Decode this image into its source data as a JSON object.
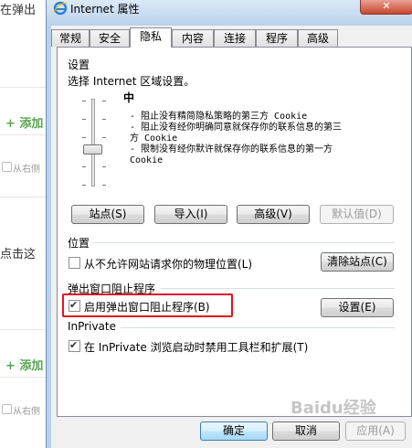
{
  "background": {
    "frag_title": "在弹出",
    "add_1": "+ 添加",
    "from_right_1": "从右侧",
    "frag_click": "点击这",
    "add_2": "+ 添加",
    "from_right_2": "从右侧"
  },
  "dialog": {
    "title": "Internet 属性",
    "close_symbol": "✕",
    "tabs": [
      "常规",
      "安全",
      "隐私",
      "内容",
      "连接",
      "程序",
      "高级"
    ],
    "active_tab": "隐私"
  },
  "settings": {
    "group_label": "设置",
    "select_label": "选择 Internet 区域设置。",
    "level": "中",
    "description": [
      "- 阻止没有精简隐私策略的第三方 Cookie",
      "- 阻止没有经你明确同意就保存你的联系信息的第三",
      "方 Cookie",
      "- 限制没有经你默许就保存你的联系信息的第一方",
      "Cookie"
    ],
    "buttons": {
      "sites": "站点(S)",
      "import": "导入(I)",
      "advanced": "高级(V)",
      "default": "默认值(D)"
    }
  },
  "location": {
    "group_label": "位置",
    "checkbox_label": "从不允许网站请求你的物理位置(L)",
    "checked": false,
    "clear_button": "清除站点(C)"
  },
  "popup": {
    "group_label": "弹出窗口阻止程序",
    "checkbox_label": "启用弹出窗口阻止程序(B)",
    "checked": true,
    "settings_button": "设置(E)"
  },
  "inprivate": {
    "group_label": "InPrivate",
    "checkbox_label": "在 InPrivate 浏览启动时禁用工具栏和扩展(T)",
    "checked": true
  },
  "footer": {
    "ok": "确定",
    "cancel": "取消",
    "apply": "应用(A)"
  },
  "colors": {
    "highlight_box": "#e0141e",
    "accent_green": "#5aa552"
  },
  "watermark": "Baidu经验"
}
